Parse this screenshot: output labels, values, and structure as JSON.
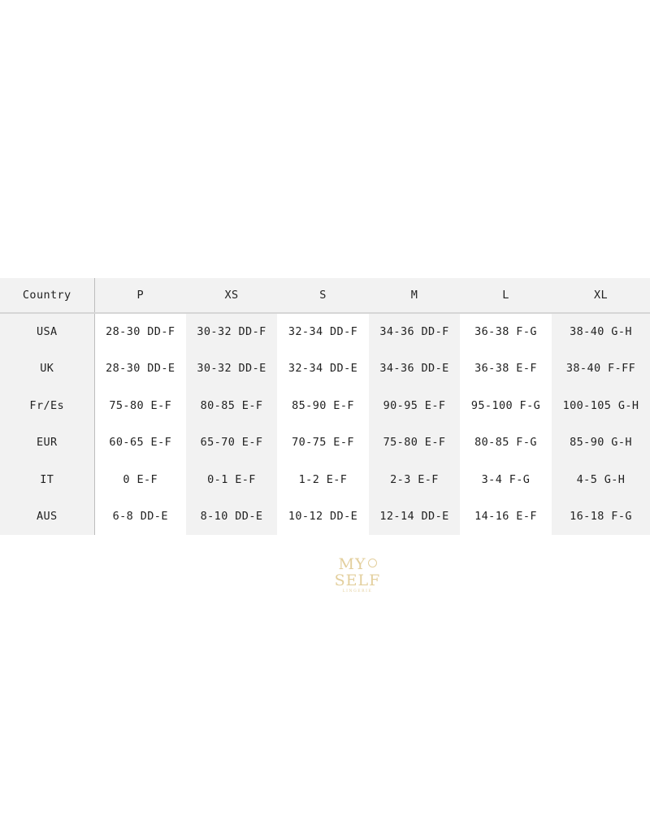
{
  "table": {
    "headers": [
      "Country",
      "P",
      "XS",
      "S",
      "M",
      "L",
      "XL"
    ],
    "rows": [
      [
        "USA",
        "28-30 DD-F",
        "30-32 DD-F",
        "32-34 DD-F",
        "34-36 DD-F",
        "36-38 F-G",
        "38-40 G-H"
      ],
      [
        "UK",
        "28-30 DD-E",
        "30-32 DD-E",
        "32-34 DD-E",
        "34-36 DD-E",
        "36-38 E-F",
        "38-40 F-FF"
      ],
      [
        "Fr/Es",
        "75-80 E-F",
        "80-85 E-F",
        "85-90 E-F",
        "90-95 E-F",
        "95-100 F-G",
        "100-105 G-H"
      ],
      [
        "EUR",
        "60-65 E-F",
        "65-70 E-F",
        "70-75 E-F",
        "75-80 E-F",
        "80-85 F-G",
        "85-90 G-H"
      ],
      [
        "IT",
        "0 E-F",
        "0-1 E-F",
        "1-2 E-F",
        "2-3 E-F",
        "3-4 F-G",
        "4-5 G-H"
      ],
      [
        "AUS",
        "6-8 DD-E",
        "8-10 DD-E",
        "10-12 DD-E",
        "12-14 DD-E",
        "14-16 E-F",
        "16-18 F-G"
      ]
    ]
  },
  "logo": {
    "line1": "MY",
    "line2": "SELF",
    "line3": "LINGERIE",
    "color": "#e3cf9d"
  },
  "colors": {
    "shade": "#f2f2f2",
    "text": "#222222"
  }
}
